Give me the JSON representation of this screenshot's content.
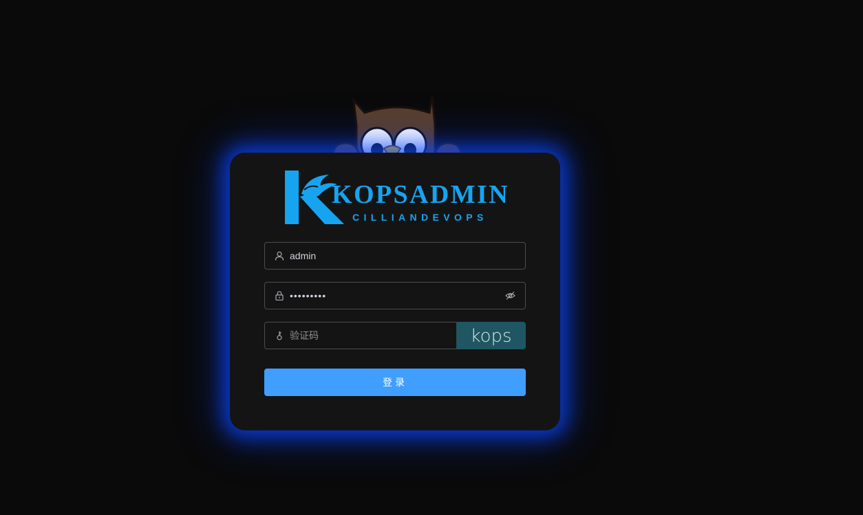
{
  "brand": {
    "title": "KOPSADMIN",
    "subtitle": "CILLIANDEVOPS",
    "color": "#16a4f0"
  },
  "form": {
    "username": {
      "value": "admin",
      "placeholder": "",
      "icon": "user-icon"
    },
    "password": {
      "value": "kopsadmin",
      "placeholder": "",
      "icon": "lock-icon",
      "toggle_icon": "eye-hidden-icon"
    },
    "captcha": {
      "value": "",
      "placeholder": "验证码",
      "icon": "key-icon",
      "image_text": "kops"
    },
    "submit_label": "登录"
  },
  "colors": {
    "background": "#0a0a0a",
    "card": "#141414",
    "glow": "#0a46ff",
    "primary_button": "#409eff",
    "captcha_bg": "#1f5662"
  }
}
